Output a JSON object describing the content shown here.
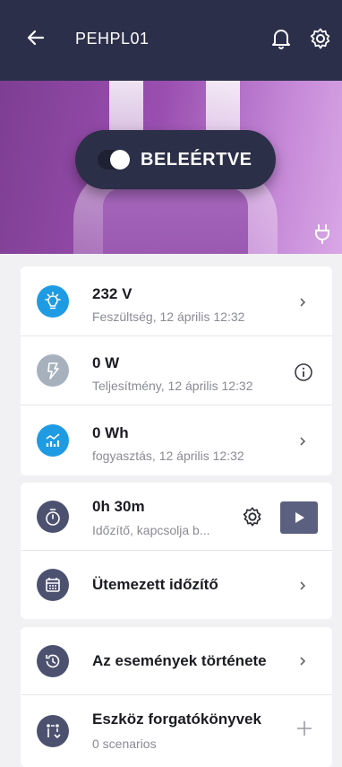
{
  "header": {
    "title": "PEHPL01"
  },
  "hero": {
    "toggle_label": "BELEÉRTVE",
    "toggle_on": true
  },
  "colors": {
    "topbar": "#2b2f4a",
    "accent_blue": "#1e9be3",
    "muted_gray": "#a7b0bd",
    "slate": "#4d5170"
  },
  "measurements": [
    {
      "icon": "bulb-icon",
      "value": "232 V",
      "sub": "Feszültség, 12 április 12:32",
      "action": "chevron"
    },
    {
      "icon": "lightning-icon",
      "value": "0 W",
      "sub": "Teljesítmény, 12 április 12:32",
      "action": "info"
    },
    {
      "icon": "energy-chart-icon",
      "value": "0 Wh",
      "sub": "fogyasztás, 12 április 12:32",
      "action": "chevron"
    }
  ],
  "timer": {
    "value": "0h 30m",
    "sub": "Időzítő, kapcsolja b...",
    "scheduled_label": "Ütemezett időzítő"
  },
  "events": {
    "history_label": "Az események története",
    "scenarios_title": "Eszköz forgatókönyvek",
    "scenarios_sub": "0 scenarios"
  }
}
